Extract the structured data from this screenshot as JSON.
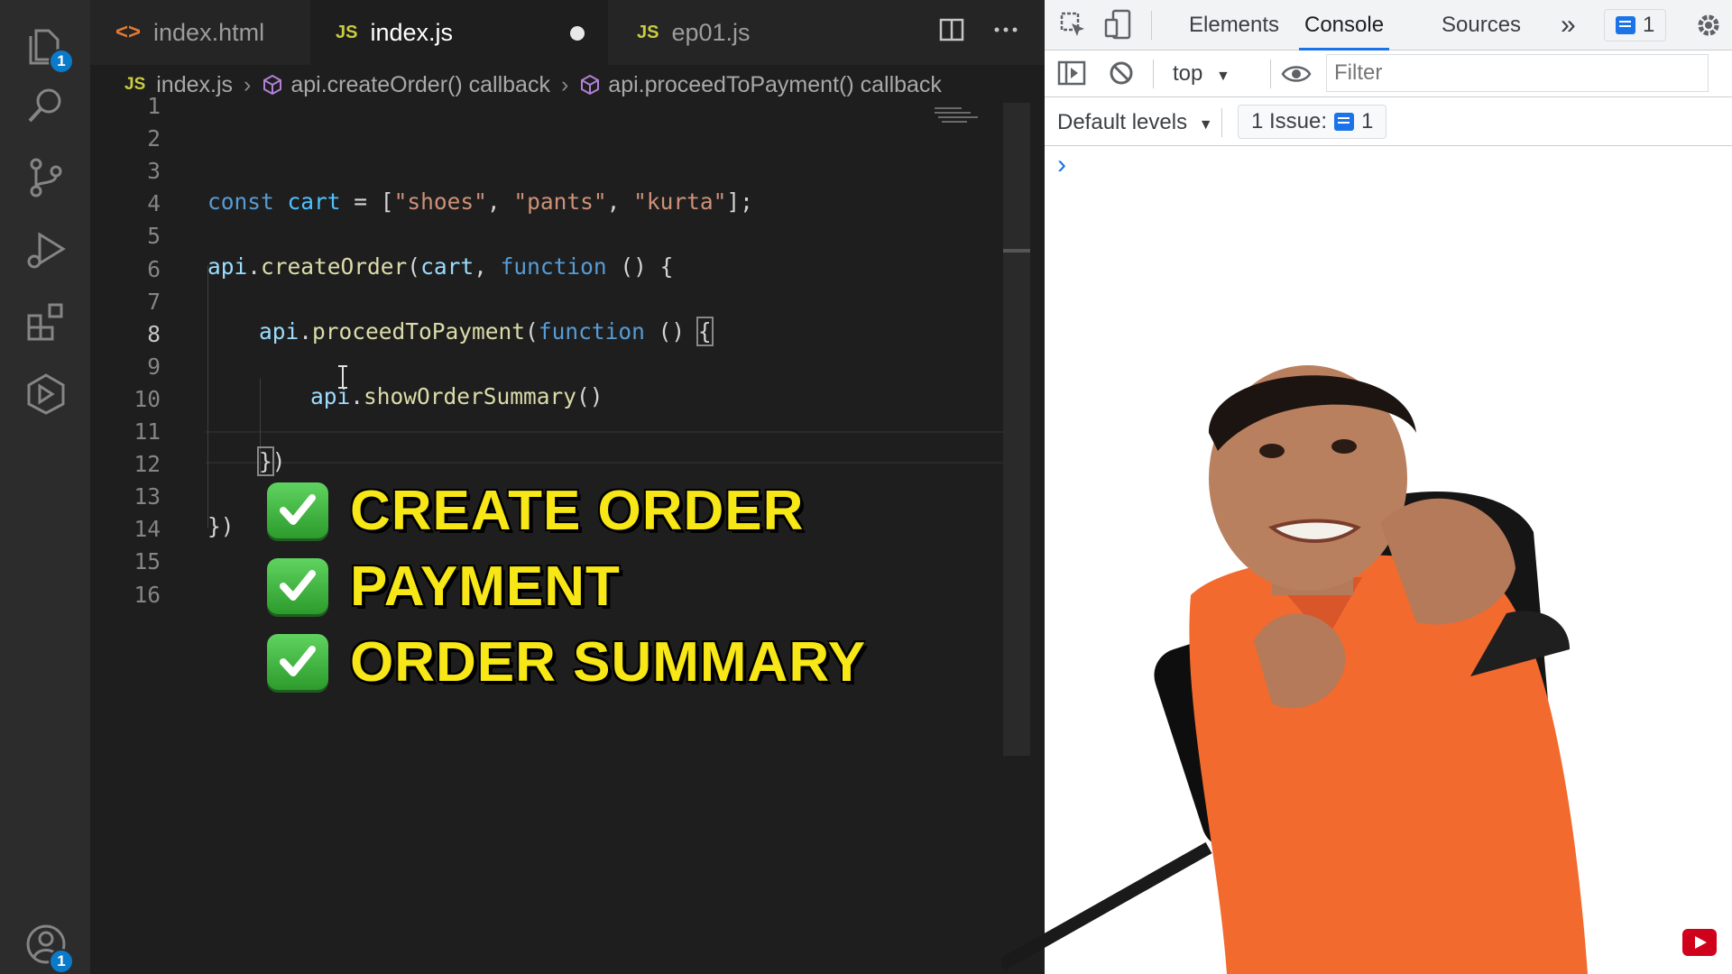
{
  "activity_bar": {
    "explorer_badge": "1",
    "accounts_badge": "1"
  },
  "tabs": [
    {
      "label": "index.html",
      "icon": "<>"
    },
    {
      "label": "index.js",
      "icon": "JS"
    },
    {
      "label": "ep01.js",
      "icon": "JS"
    }
  ],
  "breadcrumb": {
    "file_icon": "JS",
    "file": "index.js",
    "item1": "api.createOrder() callback",
    "item2": "api.proceedToPayment() callback"
  },
  "editor": {
    "line_numbers": [
      "1",
      "2",
      "3",
      "4",
      "5",
      "6",
      "7",
      "8",
      "9",
      "10",
      "11",
      "12",
      "13",
      "14",
      "15",
      "16"
    ],
    "current_line": 8,
    "code": {
      "l2": [
        {
          "t": "const",
          "c": "kw"
        },
        {
          "t": " ",
          "c": "punc"
        },
        {
          "t": "cart",
          "c": "var"
        },
        {
          "t": " = [",
          "c": "punc"
        },
        {
          "t": "\"shoes\"",
          "c": "str"
        },
        {
          "t": ", ",
          "c": "punc"
        },
        {
          "t": "\"pants\"",
          "c": "str"
        },
        {
          "t": ", ",
          "c": "punc"
        },
        {
          "t": "\"kurta\"",
          "c": "str"
        },
        {
          "t": "];",
          "c": "punc"
        }
      ],
      "l4": [
        {
          "t": "api",
          "c": "obj"
        },
        {
          "t": ".",
          "c": "punc"
        },
        {
          "t": "createOrder",
          "c": "fn"
        },
        {
          "t": "(",
          "c": "punc"
        },
        {
          "t": "cart",
          "c": "obj"
        },
        {
          "t": ", ",
          "c": "punc"
        },
        {
          "t": "function",
          "c": "kw"
        },
        {
          "t": " () {",
          "c": "punc"
        }
      ],
      "l6": [
        {
          "t": "api",
          "c": "obj"
        },
        {
          "t": ".",
          "c": "punc"
        },
        {
          "t": "proceedToPayment",
          "c": "fn"
        },
        {
          "t": "(",
          "c": "punc"
        },
        {
          "t": "function",
          "c": "kw"
        },
        {
          "t": " () ",
          "c": "punc"
        }
      ],
      "l6_bracket": "{",
      "l8": [
        {
          "t": "api",
          "c": "obj"
        },
        {
          "t": ".",
          "c": "punc"
        },
        {
          "t": "showOrderSummary",
          "c": "fn"
        },
        {
          "t": "()",
          "c": "punc"
        }
      ],
      "l10_bracket": "}",
      "l10_rest": ")",
      "l12": "})"
    }
  },
  "overlay": {
    "items": [
      "CREATE ORDER",
      "PAYMENT",
      "ORDER SUMMARY"
    ]
  },
  "devtools": {
    "tabs": [
      "Elements",
      "Console",
      "Sources"
    ],
    "active_tab": "Console",
    "more_tabs": "»",
    "messages_badge": "1",
    "context": "top",
    "filter_placeholder": "Filter",
    "levels": "Default levels",
    "issues_label": "1 Issue:",
    "issues_count": "1",
    "prompt": "›"
  },
  "colors": {
    "accent": "#1a73e8",
    "overlay_text": "#f7e716",
    "check_green": "#3cb63c",
    "shirt": "#f26a2e"
  }
}
